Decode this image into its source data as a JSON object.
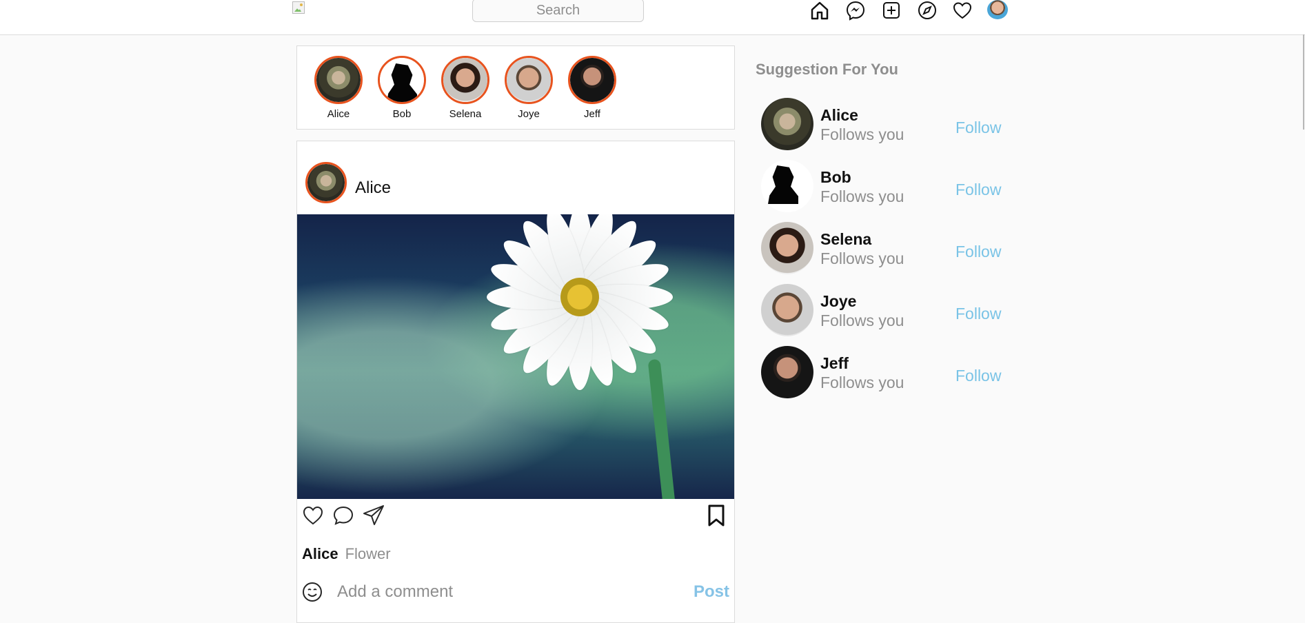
{
  "header": {
    "search_placeholder": "Search",
    "icons": [
      "home-icon",
      "messenger-icon",
      "new-post-icon",
      "explore-icon",
      "activity-heart-icon",
      "profile-avatar"
    ]
  },
  "stories": [
    {
      "name": "Alice"
    },
    {
      "name": "Bob"
    },
    {
      "name": "Selena"
    },
    {
      "name": "Joye"
    },
    {
      "name": "Jeff"
    }
  ],
  "post": {
    "username": "Alice",
    "caption_user": "Alice",
    "caption_text": "Flower",
    "comment_placeholder": "Add a comment",
    "post_label": "Post"
  },
  "suggestions": {
    "title": "Suggestion For You",
    "items": [
      {
        "name": "Alice",
        "subtitle": "Follows you",
        "action": "Follow"
      },
      {
        "name": "Bob",
        "subtitle": "Follows you",
        "action": "Follow"
      },
      {
        "name": "Selena",
        "subtitle": "Follows you",
        "action": "Follow"
      },
      {
        "name": "Joye",
        "subtitle": "Follows you",
        "action": "Follow"
      },
      {
        "name": "Jeff",
        "subtitle": "Follows you",
        "action": "Follow"
      }
    ]
  },
  "colors": {
    "story_ring": "#e8531e",
    "link_blue": "#79c3e6",
    "muted_text": "#8e8e8e",
    "border": "#dbdbdb"
  }
}
